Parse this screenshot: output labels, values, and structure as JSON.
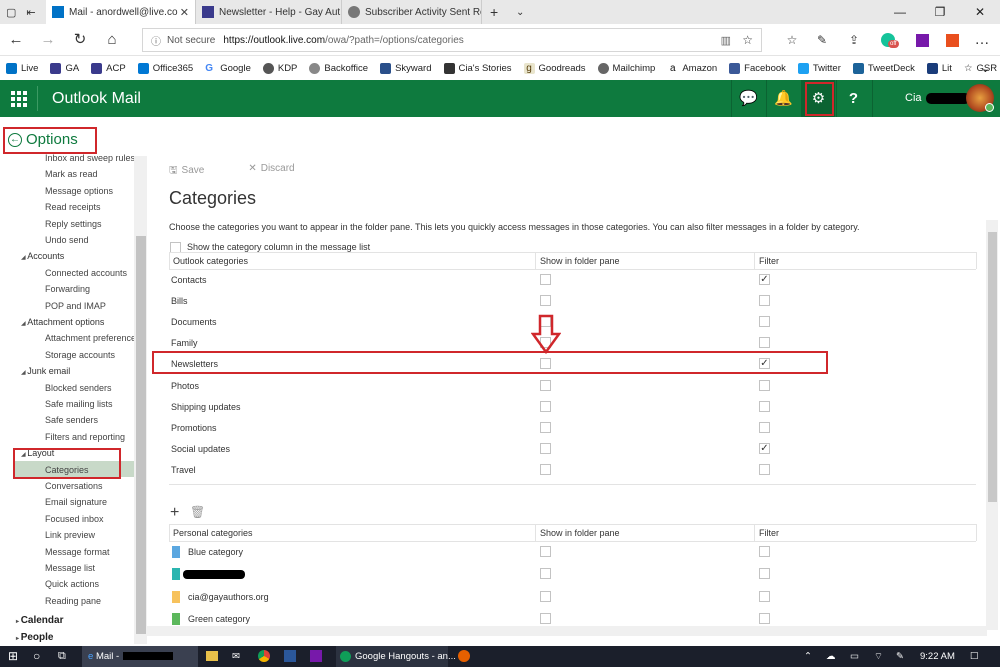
{
  "browser": {
    "tabs": [
      {
        "title": "Mail - anordwell@live.co",
        "active": true
      },
      {
        "title": "Newsletter - Help - Gay Aut",
        "active": false
      },
      {
        "title": "Subscriber Activity Sent Rep",
        "active": false
      }
    ],
    "security_label": "Not secure",
    "url_host": "https://outlook.live.com",
    "url_path": "/owa/?path=/options/categories",
    "favorites": [
      "Live",
      "GA",
      "ACP",
      "Office365",
      "Google",
      "KDP",
      "Backoffice",
      "Skyward",
      "Cia's Stories",
      "Goodreads",
      "Mailchimp",
      "Amazon",
      "Facebook",
      "Twitter",
      "TweetDeck",
      "Lit",
      "GSR"
    ]
  },
  "header": {
    "app_name": "Outlook Mail",
    "user_name": "Cia",
    "brand_color": "#0e7a3e",
    "badge_text": "off"
  },
  "sidebar": {
    "title": "Options",
    "items": [
      {
        "label": "Inbox and sweep rules",
        "level": 2
      },
      {
        "label": "Mark as read",
        "level": 2
      },
      {
        "label": "Message options",
        "level": 2
      },
      {
        "label": "Read receipts",
        "level": 2
      },
      {
        "label": "Reply settings",
        "level": 2
      },
      {
        "label": "Undo send",
        "level": 2
      },
      {
        "label": "Accounts",
        "level": 1
      },
      {
        "label": "Connected accounts",
        "level": 2
      },
      {
        "label": "Forwarding",
        "level": 2
      },
      {
        "label": "POP and IMAP",
        "level": 2
      },
      {
        "label": "Attachment options",
        "level": 1
      },
      {
        "label": "Attachment preferences",
        "level": 2
      },
      {
        "label": "Storage accounts",
        "level": 2
      },
      {
        "label": "Junk email",
        "level": 1
      },
      {
        "label": "Blocked senders",
        "level": 2
      },
      {
        "label": "Safe mailing lists",
        "level": 2
      },
      {
        "label": "Safe senders",
        "level": 2
      },
      {
        "label": "Filters and reporting",
        "level": 2
      },
      {
        "label": "Layout",
        "level": 1
      },
      {
        "label": "Categories",
        "level": 2,
        "selected": true
      },
      {
        "label": "Conversations",
        "level": 2
      },
      {
        "label": "Email signature",
        "level": 2
      },
      {
        "label": "Focused inbox",
        "level": 2
      },
      {
        "label": "Link preview",
        "level": 2
      },
      {
        "label": "Message format",
        "level": 2
      },
      {
        "label": "Message list",
        "level": 2
      },
      {
        "label": "Quick actions",
        "level": 2
      },
      {
        "label": "Reading pane",
        "level": 2
      },
      {
        "label": "Calendar",
        "level": 0
      },
      {
        "label": "People",
        "level": 0
      }
    ]
  },
  "main": {
    "save_label": "Save",
    "discard_label": "Discard",
    "page_title": "Categories",
    "description": "Choose the categories you want to appear in the folder pane. This lets you quickly access messages in those categories. You can also filter messages in a folder by category.",
    "show_column_label": "Show the category column in the message list",
    "outlook_table": {
      "headers": [
        "Outlook categories",
        "Show in folder pane",
        "Filter"
      ],
      "rows": [
        {
          "name": "Contacts",
          "show": false,
          "filter": true
        },
        {
          "name": "Bills",
          "show": false,
          "filter": false
        },
        {
          "name": "Documents",
          "show": false,
          "filter": false
        },
        {
          "name": "Family",
          "show": false,
          "filter": false
        },
        {
          "name": "Newsletters",
          "show": false,
          "filter": true
        },
        {
          "name": "Photos",
          "show": false,
          "filter": false
        },
        {
          "name": "Shipping updates",
          "show": false,
          "filter": false
        },
        {
          "name": "Promotions",
          "show": false,
          "filter": false
        },
        {
          "name": "Social updates",
          "show": false,
          "filter": true
        },
        {
          "name": "Travel",
          "show": false,
          "filter": false
        }
      ]
    },
    "personal_table": {
      "headers": [
        "Personal categories",
        "Show in folder pane",
        "Filter"
      ],
      "rows": [
        {
          "name": "Blue category",
          "color": "#5ba7e0",
          "show": false,
          "filter": false
        },
        {
          "name": "",
          "color": "#2bb5b0",
          "show": false,
          "filter": false
        },
        {
          "name": "cia@gayauthors.org",
          "color": "#f7c25c",
          "show": false,
          "filter": false
        },
        {
          "name": "Green category",
          "color": "#5cb85c",
          "show": false,
          "filter": false
        }
      ]
    }
  },
  "taskbar": {
    "mail_label": "Mail -",
    "hangouts_label": "Google Hangouts - an...",
    "time": "9:22 AM"
  }
}
